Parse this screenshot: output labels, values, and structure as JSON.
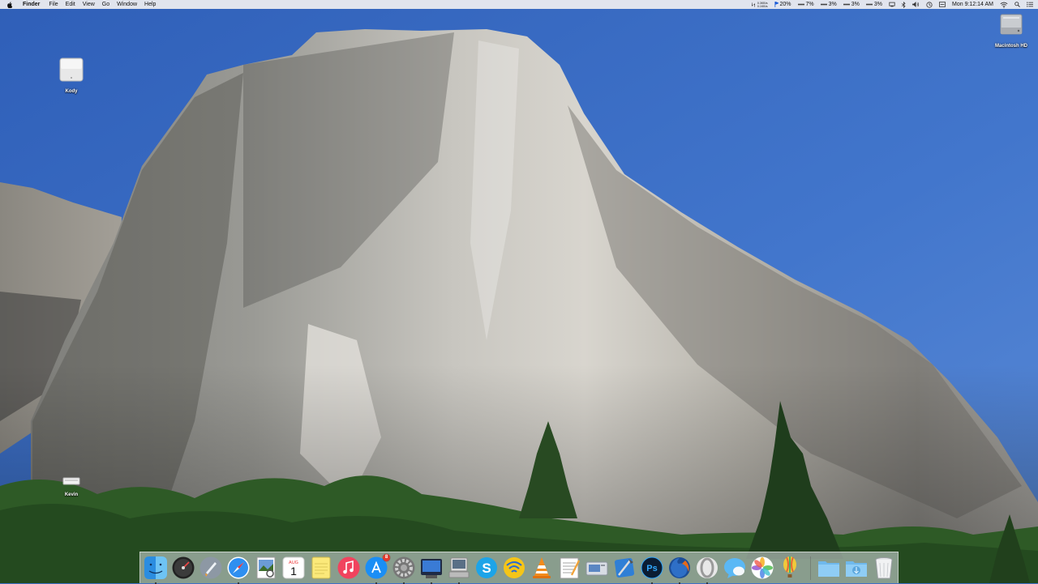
{
  "menubar": {
    "app_name": "Finder",
    "menus": [
      "File",
      "Edit",
      "View",
      "Go",
      "Window",
      "Help"
    ],
    "status": {
      "net_up": "0.3KB/s",
      "net_down": "0.1KB/s",
      "battery_pct": "20%",
      "cpu_pct": "7%",
      "mem_pct": "3%",
      "disk_pct": "3%",
      "temp_pct": "3%",
      "clock": "Mon 9:12:14 AM"
    }
  },
  "desktop": {
    "icons": [
      {
        "label": "Kody",
        "icon": "server-drive-icon"
      },
      {
        "label": "Kevin",
        "icon": "usb-drive-icon"
      },
      {
        "label": "Macintosh HD",
        "icon": "hard-drive-icon"
      }
    ]
  },
  "dock": {
    "apps": [
      {
        "name": "Finder",
        "icon": "finder-icon"
      },
      {
        "name": "Dashboard",
        "icon": "dashboard-icon"
      },
      {
        "name": "Launchpad",
        "icon": "launchpad-icon"
      },
      {
        "name": "Safari",
        "icon": "safari-icon"
      },
      {
        "name": "Preview",
        "icon": "preview-icon"
      },
      {
        "name": "Calendar",
        "icon": "calendar-icon",
        "month": "AUG",
        "day": "1"
      },
      {
        "name": "Notes",
        "icon": "notes-icon"
      },
      {
        "name": "iTunes",
        "icon": "itunes-icon"
      },
      {
        "name": "App Store",
        "icon": "app-store-icon",
        "badge": "8"
      },
      {
        "name": "System Preferences",
        "icon": "gear-icon"
      },
      {
        "name": "QuickTime",
        "icon": "quicktime-icon"
      },
      {
        "name": "Disk Utility",
        "icon": "disk-utility-icon"
      },
      {
        "name": "Skype",
        "icon": "skype-icon"
      },
      {
        "name": "Wi-Fi Explorer",
        "icon": "wifi-explorer-icon"
      },
      {
        "name": "VLC",
        "icon": "vlc-cone-icon"
      },
      {
        "name": "TextEdit",
        "icon": "textedit-icon"
      },
      {
        "name": "Image Capture",
        "icon": "image-capture-icon"
      },
      {
        "name": "Xcode",
        "icon": "xcode-icon"
      },
      {
        "name": "Photoshop",
        "icon": "photoshop-icon",
        "text": "Ps"
      },
      {
        "name": "Firefox",
        "icon": "firefox-icon"
      },
      {
        "name": "Opera",
        "icon": "opera-icon"
      },
      {
        "name": "Messages",
        "icon": "messages-icon"
      },
      {
        "name": "Photos",
        "icon": "photos-icon"
      },
      {
        "name": "Maps",
        "icon": "balloon-icon"
      },
      {
        "name": "Applications",
        "icon": "folder-icon"
      },
      {
        "name": "Downloads",
        "icon": "downloads-folder-icon"
      },
      {
        "name": "Trash",
        "icon": "trash-icon"
      }
    ]
  },
  "colors": {
    "sky": "#3f6fc4",
    "menubar": "#ececf0",
    "badge": "#e23b2e"
  }
}
